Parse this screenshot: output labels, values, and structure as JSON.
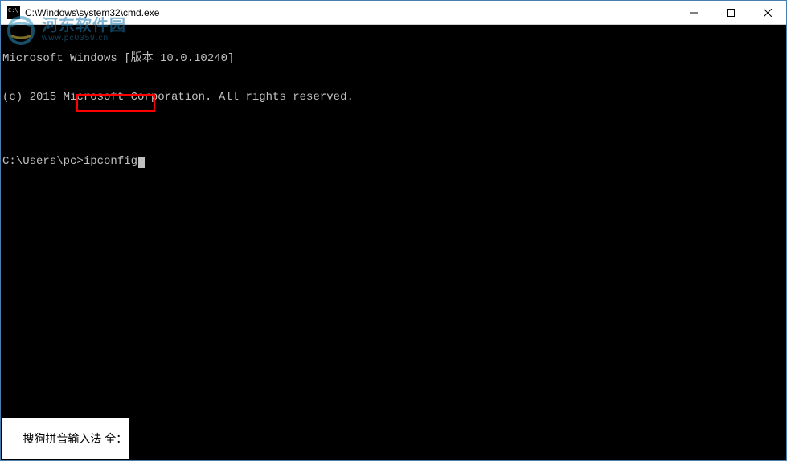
{
  "titlebar": {
    "title": "C:\\Windows\\system32\\cmd.exe"
  },
  "terminal": {
    "line1": "Microsoft Windows [版本 10.0.10240]",
    "line2": "(c) 2015 Microsoft Corporation. All rights reserved.",
    "line3": "",
    "prompt": "C:\\Users\\pc>",
    "command": "ipconfig"
  },
  "ime": {
    "text": "搜狗拼音输入法 全："
  },
  "watermark": {
    "main": "河东软件园",
    "sub": "www.pc0359.cn"
  }
}
